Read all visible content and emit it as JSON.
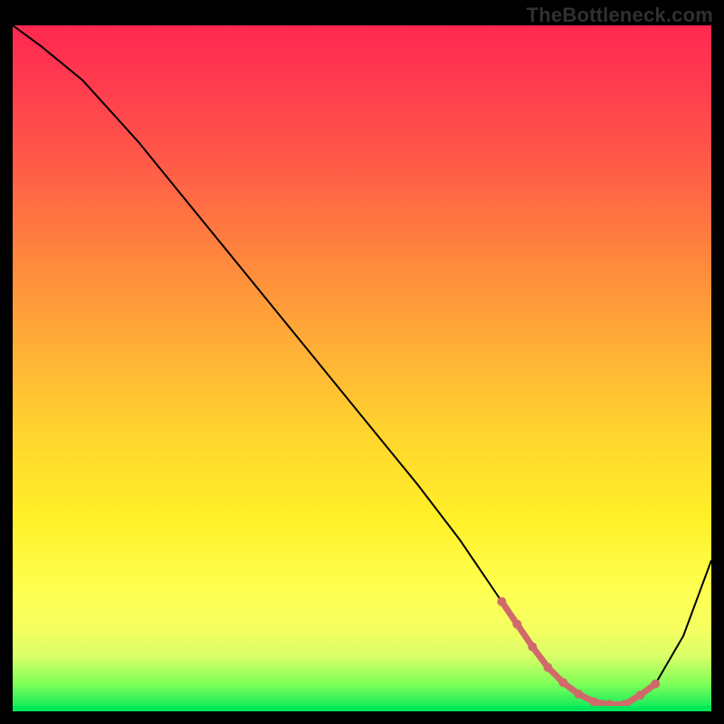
{
  "domain": "Chart",
  "watermark": "TheBottleneck.com",
  "chart_data": {
    "type": "line",
    "title": "",
    "xlabel": "",
    "ylabel": "",
    "xlim": [
      0,
      100
    ],
    "ylim": [
      0,
      100
    ],
    "grid": false,
    "legend": false,
    "background": "vertical rainbow gradient from red (top) to green (bottom)",
    "series": [
      {
        "name": "bottleneck-curve",
        "x": [
          0,
          4,
          10,
          18,
          26,
          34,
          42,
          50,
          58,
          64,
          68,
          72,
          76,
          80,
          84,
          88,
          92,
          96,
          100
        ],
        "values": [
          100,
          97,
          92,
          83,
          73,
          63,
          53,
          43,
          33,
          25,
          19,
          13,
          7,
          3,
          1,
          1,
          4,
          11,
          22
        ]
      }
    ],
    "highlight_region": {
      "description": "pink rounded dots along the valley/minimum of the curve",
      "x_range": [
        70,
        92
      ],
      "approx_y": 2
    },
    "colors": {
      "curve": "#000000",
      "highlight": "#d06a6a",
      "gradient_top": "#ff2850",
      "gradient_bottom": "#00e85a",
      "page_background": "#000000"
    }
  }
}
